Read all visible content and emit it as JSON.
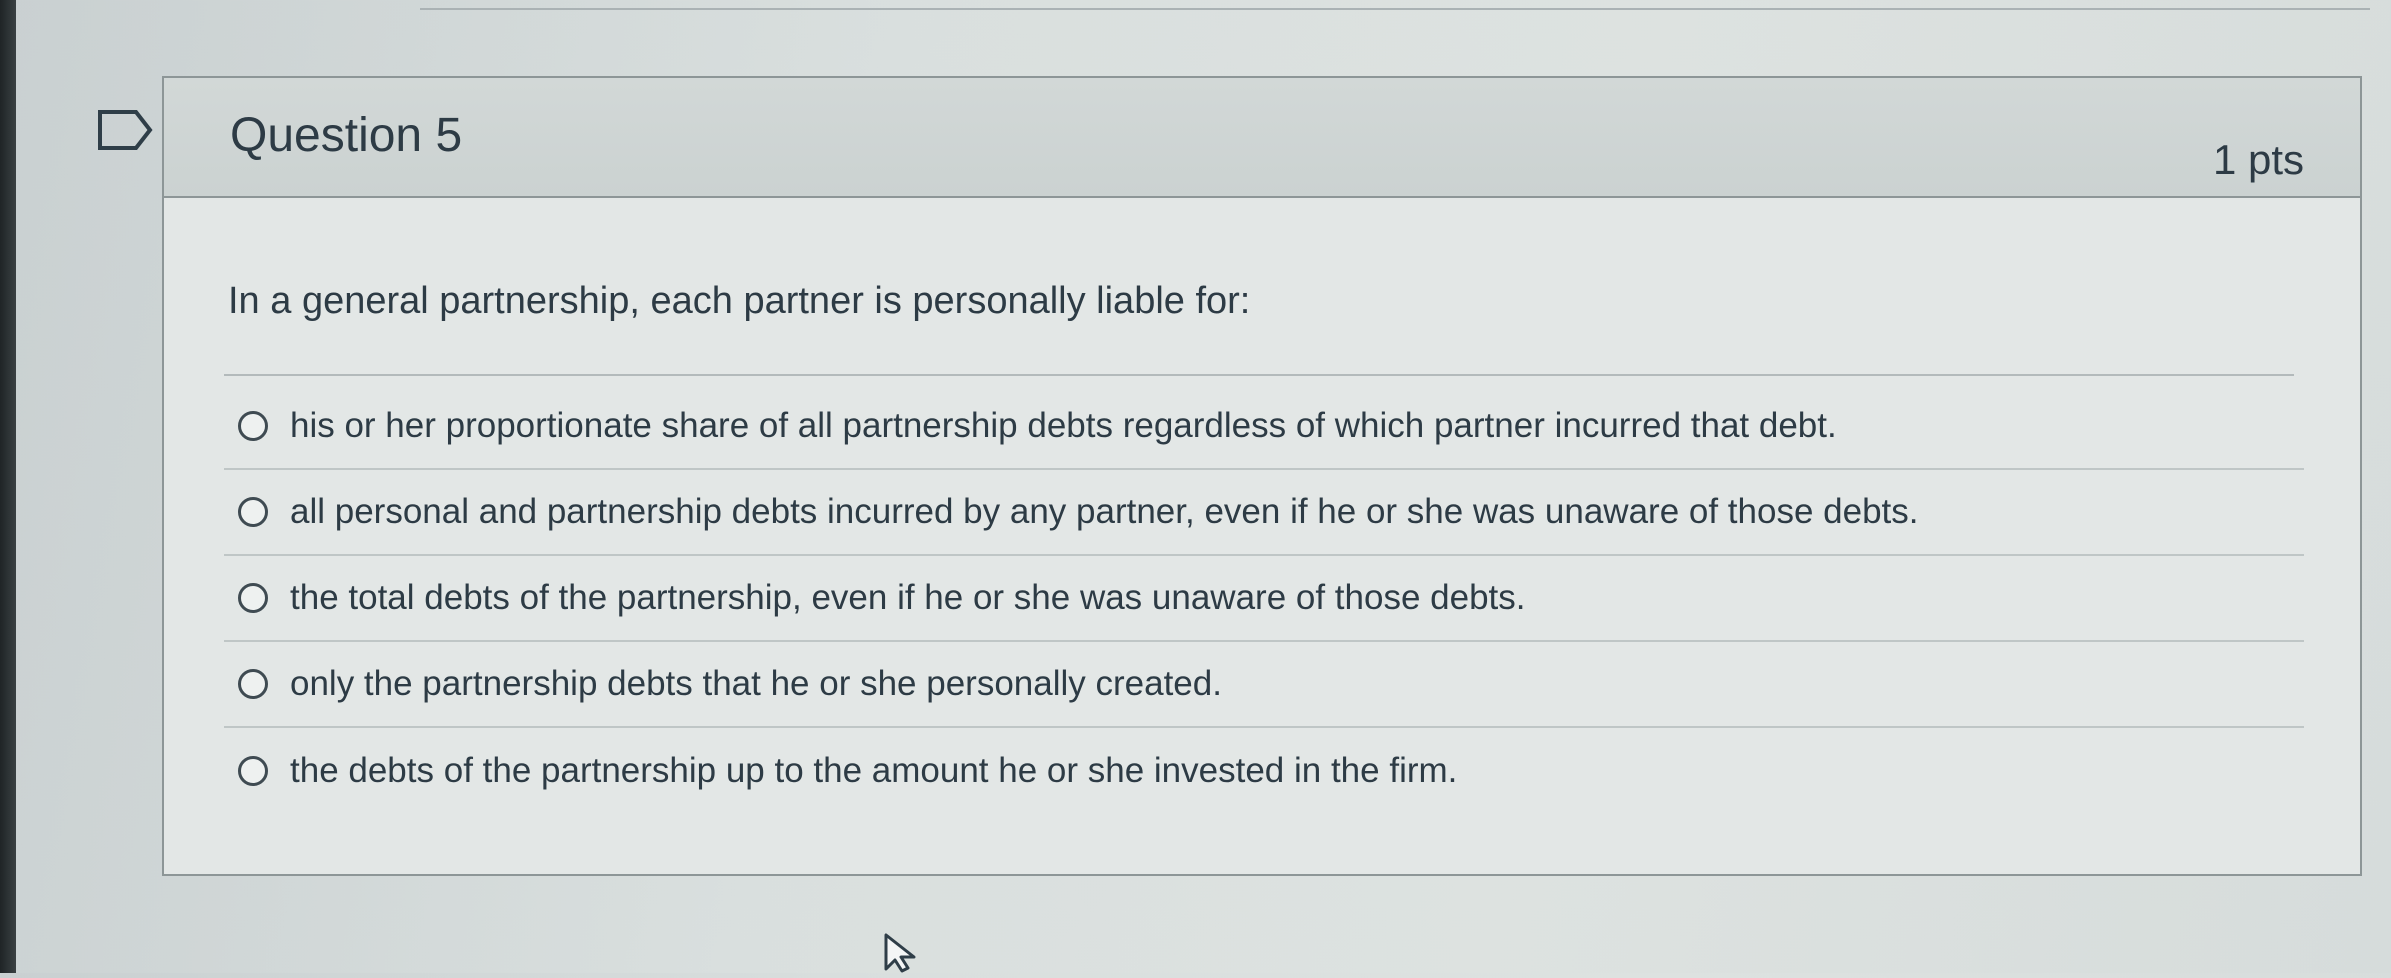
{
  "question": {
    "title": "Question 5",
    "points": "1 pts",
    "prompt": "In a general partnership, each partner is personally liable for:",
    "answers": [
      "his or her proportionate share of all partnership debts regardless of which partner incurred that debt.",
      "all personal and partnership debts incurred by any partner, even if he or she was unaware of those debts.",
      "the total debts of the partnership, even if he or she was unaware of those debts.",
      "only the partnership debts that he or she personally created.",
      "the debts of the partnership up to the amount he or she invested in the firm."
    ]
  },
  "icons": {
    "flag": "flag-icon",
    "cursor": "mouse-pointer-icon"
  },
  "colors": {
    "text": "#2d3b45",
    "border": "#8d9697",
    "header_bg": "#cbd2d1"
  }
}
